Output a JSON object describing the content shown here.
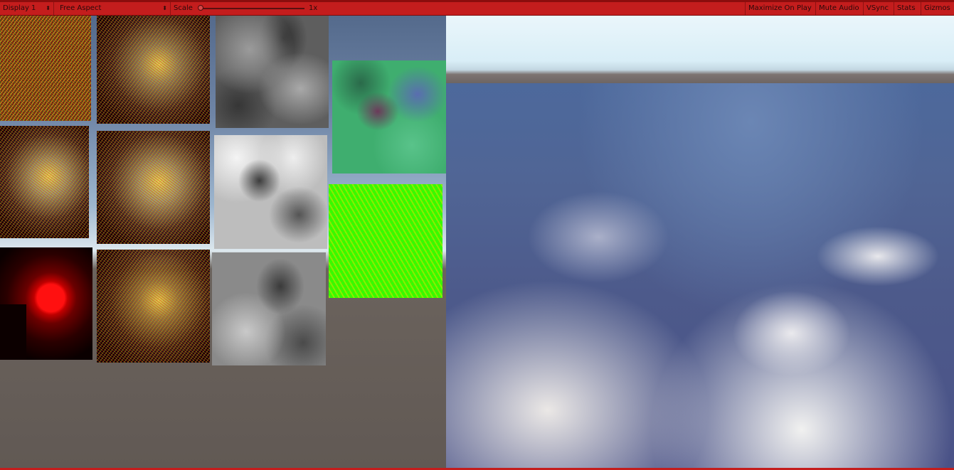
{
  "toolbar": {
    "display": "Display 1",
    "aspect": "Free Aspect",
    "scale_label": "Scale",
    "scale_value": "1x",
    "scale_fraction": 0.0,
    "right_buttons": [
      "Maximize On Play",
      "Mute Audio",
      "VSync",
      "Stats",
      "Gizmos"
    ]
  },
  "colors": {
    "toolbar_bg": "#c41d1d",
    "sky": "#d9eef7",
    "water": "#4d5a8b",
    "background": "#615954"
  },
  "icons": {
    "display_dropdown": "chevron-down-icon",
    "aspect_dropdown": "chevron-down-icon",
    "scale_slider": "slider-thumb"
  }
}
